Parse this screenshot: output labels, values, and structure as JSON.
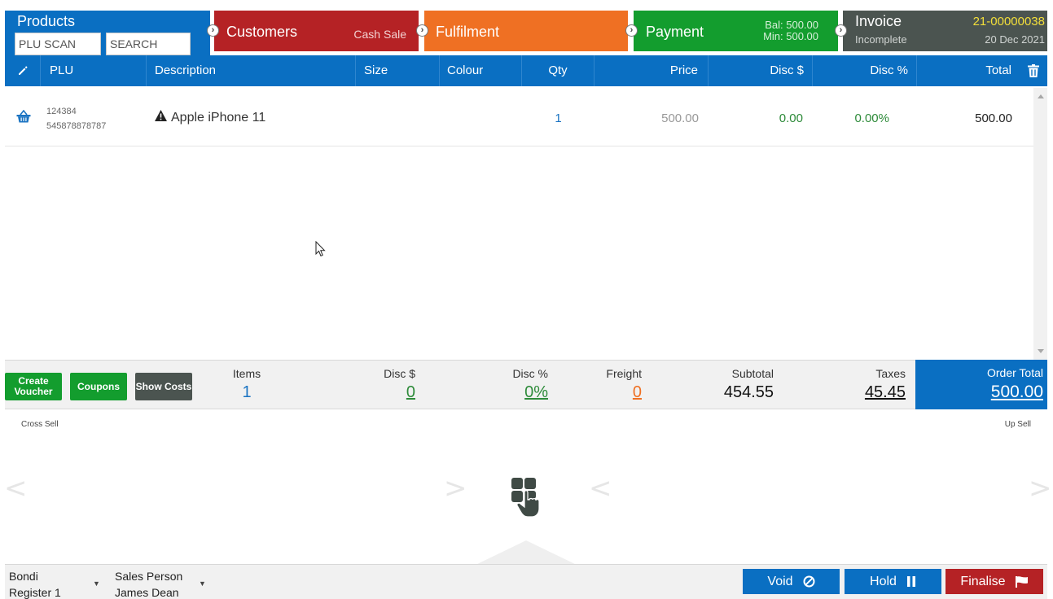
{
  "steps": {
    "products": {
      "title": "Products",
      "plu_placeholder": "PLU SCAN",
      "search_placeholder": "SEARCH"
    },
    "customers": {
      "title": "Customers",
      "sub": "Cash Sale"
    },
    "fulfilment": {
      "title": "Fulfilment"
    },
    "payment": {
      "title": "Payment",
      "bal": "Bal:  500.00",
      "min": "Min:  500.00"
    },
    "invoice": {
      "title": "Invoice",
      "number": "21-00000038",
      "status": "Incomplete",
      "date": "20 Dec 2021"
    },
    "chevron_glyph": "›"
  },
  "table": {
    "columns": {
      "plu": "PLU",
      "description": "Description",
      "size": "Size",
      "colour": "Colour",
      "qty": "Qty",
      "price": "Price",
      "disc_amount": "Disc $",
      "disc_percent": "Disc %",
      "total": "Total"
    },
    "rows": [
      {
        "plu": "124384",
        "barcode": "545878878787",
        "description": "Apple iPhone 11",
        "size": "",
        "colour": "",
        "qty": "1",
        "price": "500.00",
        "disc_amount": "0.00",
        "disc_percent": "0.00%",
        "total": "500.00"
      }
    ]
  },
  "totals": {
    "buttons": {
      "create_voucher": "Create Voucher",
      "coupons": "Coupons",
      "show_costs": "Show Costs"
    },
    "items": {
      "label": "Items",
      "value": "1"
    },
    "disc_amount": {
      "label": "Disc $",
      "value": "0"
    },
    "disc_percent": {
      "label": "Disc %",
      "value": "0%"
    },
    "freight": {
      "label": "Freight",
      "value": "0"
    },
    "subtotal": {
      "label": "Subtotal",
      "value": "454.55"
    },
    "taxes": {
      "label": "Taxes",
      "value": "45.45"
    },
    "order_total": {
      "label": "Order Total",
      "value": "500.00"
    }
  },
  "sell": {
    "cross_label": "Cross Sell",
    "up_label": "Up Sell",
    "prev_glyph": "<",
    "next_glyph": ">"
  },
  "footer": {
    "location": "Bondi",
    "register": "Register 1",
    "sales_person_label": "Sales Person",
    "sales_person": "James Dean",
    "caret_glyph": "▼",
    "void": "Void",
    "hold": "Hold",
    "finalise": "Finalise"
  },
  "colors": {
    "blue": "#0a6fc2",
    "red": "#b52225",
    "orange": "#ef7023",
    "green": "#139d2e",
    "dark": "#4b5450"
  },
  "icons": [
    "pencil-icon",
    "trash-icon",
    "basket-icon",
    "warning-icon",
    "touch-icon",
    "ban-icon",
    "pause-icon",
    "flag-icon",
    "chevron-right-icon",
    "caret-down-icon"
  ]
}
